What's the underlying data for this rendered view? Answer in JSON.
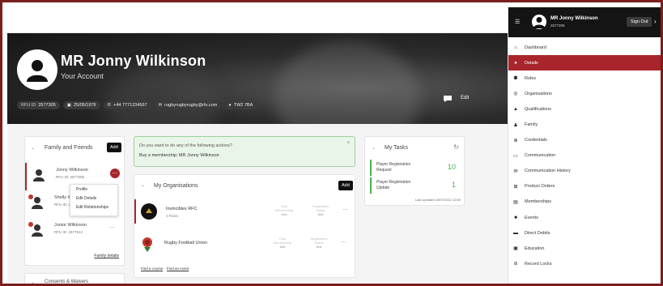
{
  "hero": {
    "name": "MR Jonny Wilkinson",
    "subtitle": "Your Account",
    "chips": [
      {
        "label": "RFU ID",
        "value": "2577305"
      },
      {
        "label": "",
        "value": "25/05/1979"
      },
      {
        "label": "",
        "value": "+44 7771234567"
      },
      {
        "label": "",
        "value": "rugbyrugbyrugby@rfu.com"
      },
      {
        "label": "",
        "value": "TW2 7BA"
      }
    ],
    "edit_label": "Edit"
  },
  "family": {
    "title": "Family and Friends",
    "add_label": "Add",
    "members": [
      {
        "name": "Jonny Wilkinson",
        "id": "RFU ID: 2577305"
      },
      {
        "name": "Shelly W",
        "id": "RFU ID: 2"
      },
      {
        "name": "Junior Wilkinson",
        "id": "RFU ID: 2577514"
      }
    ],
    "menu": [
      "Profile",
      "Edit Details",
      "Edit Relationships"
    ],
    "link": "Family details"
  },
  "consents": {
    "title": "Consents & Waivers"
  },
  "banner": {
    "question": "Do you want to do any of the following actions?",
    "action": "Buy a membership: MR Jonny Wilkinson",
    "close": "×"
  },
  "organisations": {
    "title": "My Organisations",
    "add_label": "Add",
    "rows": [
      {
        "name": "Invincibles RFC",
        "sub": "3 Roles",
        "col1": "Club Membership",
        "col1_val": "Join",
        "col2": "Registration Status",
        "col2_val": "N/A"
      },
      {
        "name": "Rugby Football Union",
        "sub": "",
        "col1": "Club Membership",
        "col1_val": "N/A",
        "col2": "Registration Status",
        "col2_val": "N/A"
      }
    ],
    "link1": "Find a course",
    "link2": "Find an event"
  },
  "tasks": {
    "title": "My Tasks",
    "items": [
      {
        "text1": "Player Registration",
        "text2": "Request",
        "count": "10"
      },
      {
        "text1": "Player Registration",
        "text2": "Update",
        "count": "1"
      }
    ],
    "updated": "Last Updated 15/07/2022 12:00"
  },
  "sidebar": {
    "user_name": "MR Jonny Wilkinson",
    "user_id": "2577305",
    "signout_label": "Sign Out",
    "items": [
      {
        "label": "Dashboard",
        "icon": "home-icon",
        "active": false
      },
      {
        "label": "Details",
        "icon": "person-icon",
        "active": true
      },
      {
        "label": "Roles",
        "icon": "roles-icon",
        "active": false
      },
      {
        "label": "Organisations",
        "icon": "organisation-icon",
        "active": false
      },
      {
        "label": "Qualifications",
        "icon": "graduation-cap-icon",
        "active": false
      },
      {
        "label": "Family",
        "icon": "family-icon",
        "active": false
      },
      {
        "label": "Credentials",
        "icon": "credentials-icon",
        "active": false
      },
      {
        "label": "Communication",
        "icon": "chat-icon",
        "active": false
      },
      {
        "label": "Communication History",
        "icon": "mail-icon",
        "active": false
      },
      {
        "label": "Product Orders",
        "icon": "cart-icon",
        "active": false
      },
      {
        "label": "Memberships",
        "icon": "membership-icon",
        "active": false
      },
      {
        "label": "Events",
        "icon": "events-icon",
        "active": false
      },
      {
        "label": "Direct Debits",
        "icon": "card-icon",
        "active": false
      },
      {
        "label": "Education",
        "icon": "education-icon",
        "active": false
      },
      {
        "label": "Record Locks",
        "icon": "lock-icon",
        "active": false
      }
    ]
  }
}
